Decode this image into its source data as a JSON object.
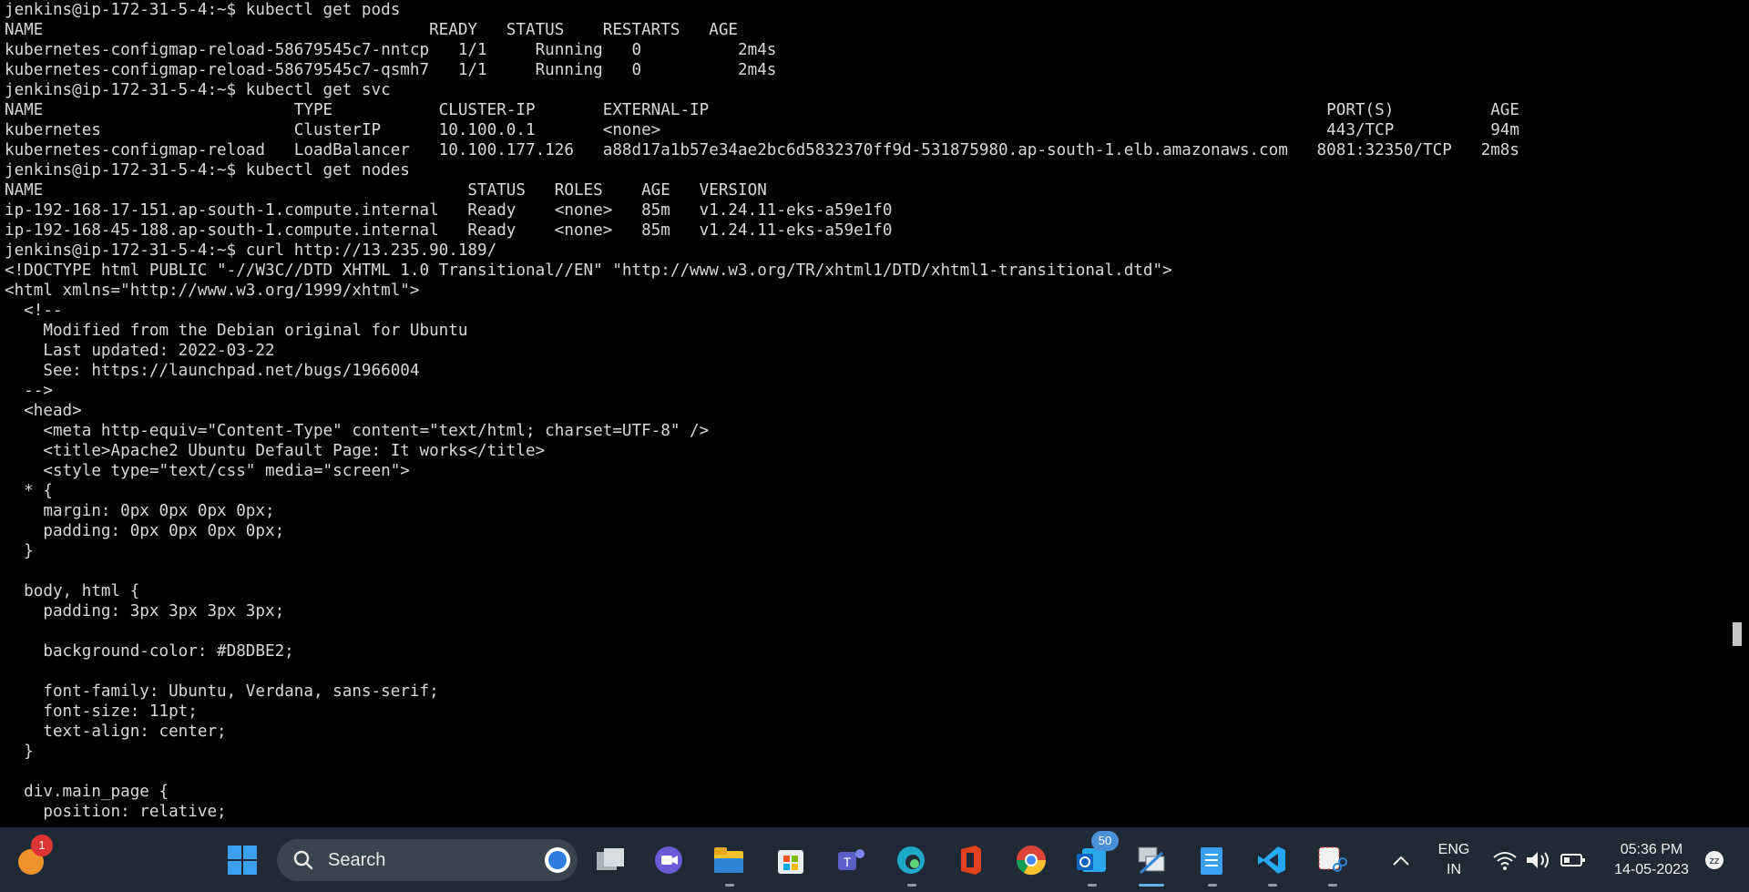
{
  "terminal": {
    "lines": [
      "jenkins@ip-172-31-5-4:~$ kubectl get pods",
      "NAME                                        READY   STATUS    RESTARTS   AGE",
      "kubernetes-configmap-reload-58679545c7-nntcp   1/1     Running   0          2m4s",
      "kubernetes-configmap-reload-58679545c7-qsmh7   1/1     Running   0          2m4s",
      "jenkins@ip-172-31-5-4:~$ kubectl get svc",
      "NAME                          TYPE           CLUSTER-IP       EXTERNAL-IP                                                                PORT(S)          AGE",
      "kubernetes                    ClusterIP      10.100.0.1       <none>                                                                     443/TCP          94m",
      "kubernetes-configmap-reload   LoadBalancer   10.100.177.126   a88d17a1b57e34ae2bc6d5832370ff9d-531875980.ap-south-1.elb.amazonaws.com   8081:32350/TCP   2m8s",
      "jenkins@ip-172-31-5-4:~$ kubectl get nodes",
      "NAME                                            STATUS   ROLES    AGE   VERSION",
      "ip-192-168-17-151.ap-south-1.compute.internal   Ready    <none>   85m   v1.24.11-eks-a59e1f0",
      "ip-192-168-45-188.ap-south-1.compute.internal   Ready    <none>   85m   v1.24.11-eks-a59e1f0",
      "jenkins@ip-172-31-5-4:~$ curl http://13.235.90.189/",
      "<!DOCTYPE html PUBLIC \"-//W3C//DTD XHTML 1.0 Transitional//EN\" \"http://www.w3.org/TR/xhtml1/DTD/xhtml1-transitional.dtd\">",
      "<html xmlns=\"http://www.w3.org/1999/xhtml\">",
      "  <!--",
      "    Modified from the Debian original for Ubuntu",
      "    Last updated: 2022-03-22",
      "    See: https://launchpad.net/bugs/1966004",
      "  -->",
      "  <head>",
      "    <meta http-equiv=\"Content-Type\" content=\"text/html; charset=UTF-8\" />",
      "    <title>Apache2 Ubuntu Default Page: It works</title>",
      "    <style type=\"text/css\" media=\"screen\">",
      "  * {",
      "    margin: 0px 0px 0px 0px;",
      "    padding: 0px 0px 0px 0px;",
      "  }",
      "",
      "  body, html {",
      "    padding: 3px 3px 3px 3px;",
      "",
      "    background-color: #D8DBE2;",
      "",
      "    font-family: Ubuntu, Verdana, sans-serif;",
      "    font-size: 11pt;",
      "    text-align: center;",
      "  }",
      "",
      "  div.main_page {",
      "    position: relative;"
    ]
  },
  "taskbar": {
    "notification_count": "1",
    "search_placeholder": "Search",
    "outlook_badge": "50",
    "language_top": "ENG",
    "language_bottom": "IN",
    "time": "05:36 PM",
    "date": "14-05-2023"
  },
  "colors": {
    "terminal_bg": "#000000",
    "terminal_fg": "#d8d8d8",
    "taskbar_bg": "#1f2a36"
  }
}
